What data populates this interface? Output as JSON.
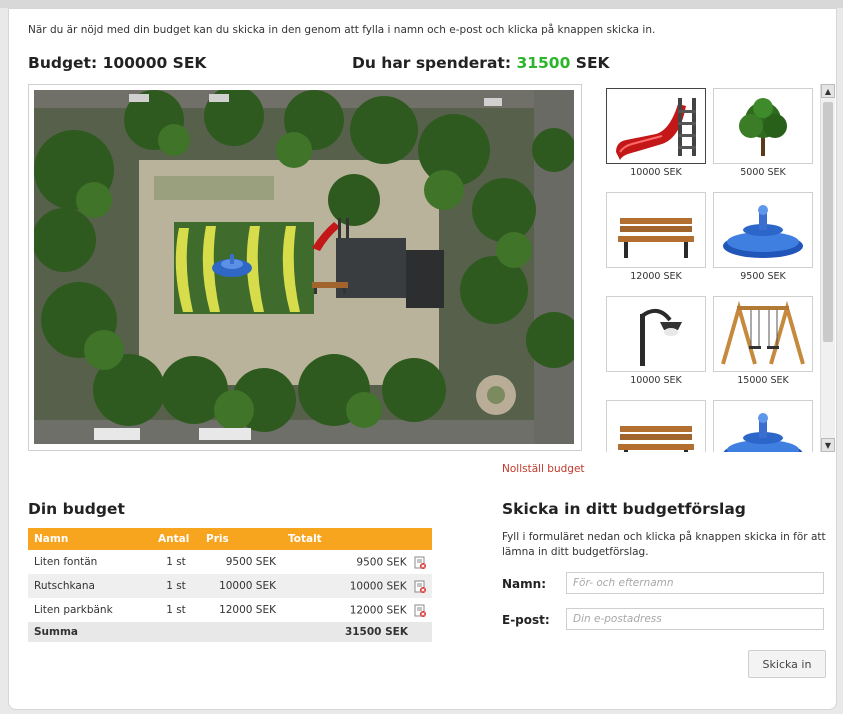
{
  "intro": "När du är nöjd med din budget kan du skicka in den genom att fylla i namn och e-post och klicka på knappen skicka in.",
  "budget": {
    "label": "Budget:",
    "value": "100000 SEK"
  },
  "spent": {
    "label": "Du har spenderat:",
    "value": "31500",
    "unit": "SEK",
    "color": "#2bb52b"
  },
  "catalog": [
    {
      "name": "slide",
      "price": "10000 SEK",
      "selected": true
    },
    {
      "name": "tree",
      "price": "5000 SEK"
    },
    {
      "name": "bench",
      "price": "12000 SEK"
    },
    {
      "name": "fountain",
      "price": "9500 SEK"
    },
    {
      "name": "lamp",
      "price": "10000 SEK"
    },
    {
      "name": "swing",
      "price": "15000 SEK"
    },
    {
      "name": "bench",
      "price": ""
    },
    {
      "name": "fountain",
      "price": ""
    }
  ],
  "reset_label": "Nollställ budget",
  "din_budget": {
    "title": "Din budget",
    "headers": {
      "name": "Namn",
      "qty": "Antal",
      "price": "Pris",
      "total": "Totalt"
    },
    "rows": [
      {
        "name": "Liten fontän",
        "qty": "1 st",
        "price": "9500 SEK",
        "total": "9500 SEK"
      },
      {
        "name": "Rutschkana",
        "qty": "1 st",
        "price": "10000 SEK",
        "total": "10000 SEK"
      },
      {
        "name": "Liten parkbänk",
        "qty": "1 st",
        "price": "12000 SEK",
        "total": "12000 SEK"
      }
    ],
    "sum_label": "Summa",
    "sum_value": "31500 SEK"
  },
  "form": {
    "title": "Skicka in ditt budgetförslag",
    "description": "Fyll i formuläret nedan och klicka på knappen skicka in för att lämna in ditt budgetförslag.",
    "name_label": "Namn:",
    "name_placeholder": "För- och efternamn",
    "email_label": "E-post:",
    "email_placeholder": "Din e-postadress",
    "submit_label": "Skicka in"
  },
  "colors": {
    "table_header": "#f7a41e",
    "reset_link": "#c0392b"
  }
}
